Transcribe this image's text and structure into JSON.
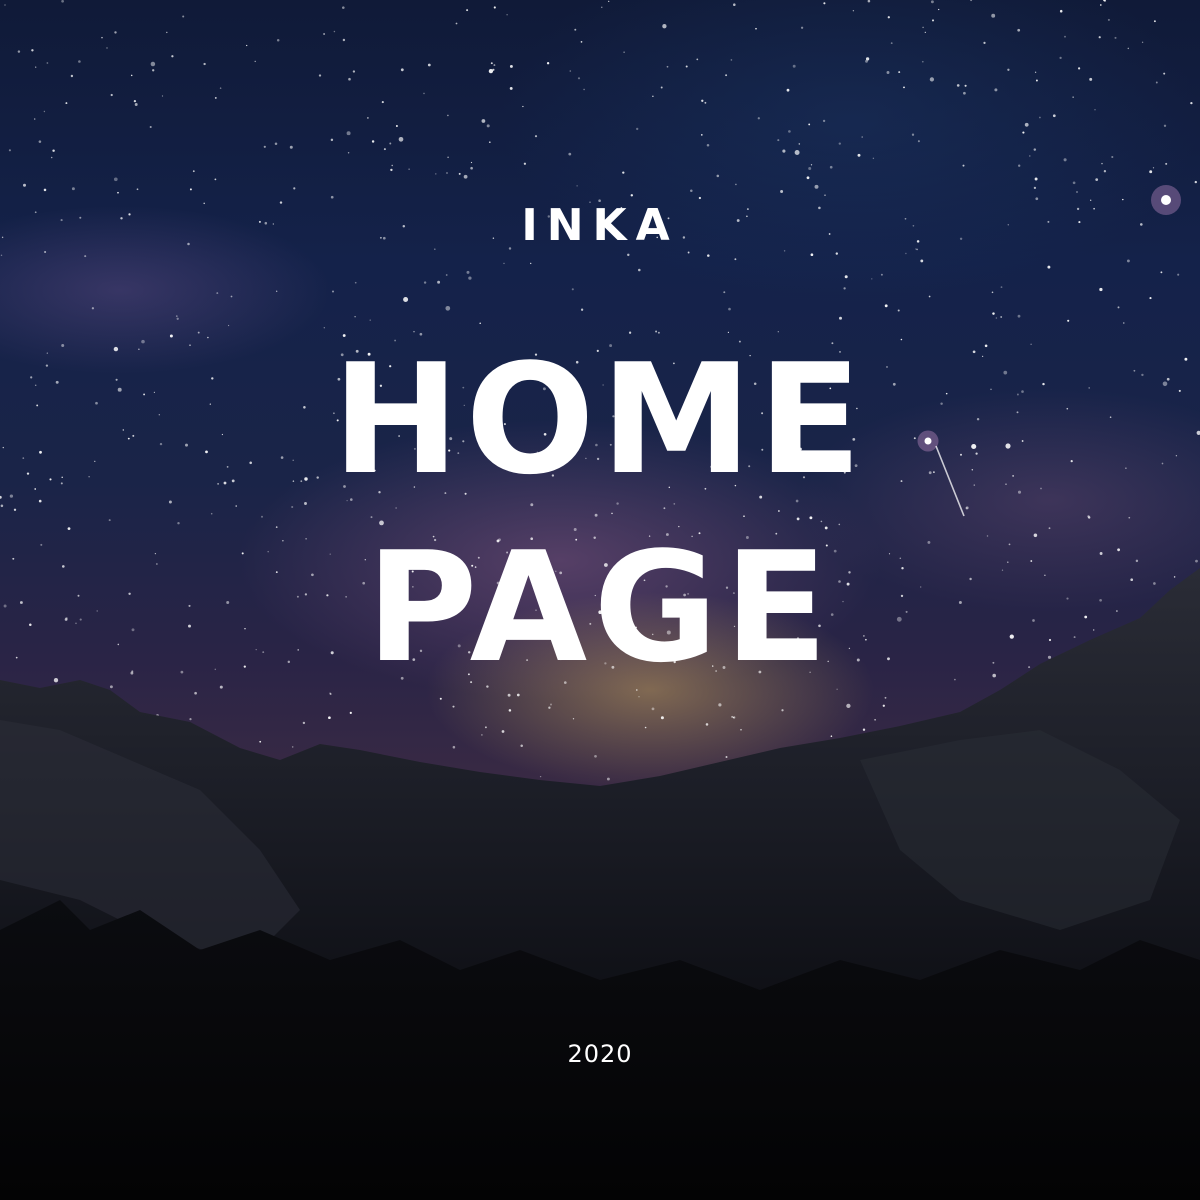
{
  "cover": {
    "brand": "INKA",
    "headline_line1": "HOME",
    "headline_line2": "PAGE",
    "year": "2020"
  },
  "background": {
    "scene": "starry night sky over mountain ridge",
    "colors": {
      "sky_top": "#101a38",
      "milky_way_glow": "#c4a05c",
      "nebula_purple": "#96608c",
      "mountain": "#1c1e26",
      "foreground": "#050507"
    }
  }
}
